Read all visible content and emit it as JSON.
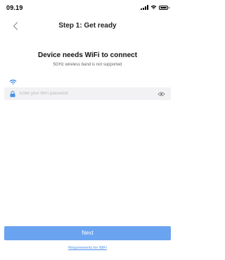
{
  "status_bar": {
    "time": "09.19"
  },
  "nav": {
    "title": "Step 1: Get ready"
  },
  "main": {
    "heading": "Device needs WiFi to connect",
    "subheading": "5GHz wireless band is not supported"
  },
  "password": {
    "placeholder": "Enter your WiFi password",
    "value": ""
  },
  "actions": {
    "next_label": "Next",
    "requirements_link": "Requirements for WiFi"
  },
  "colors": {
    "accent": "#6aa3f0",
    "link": "#4a8fe8",
    "field_bg": "#f2f2f4"
  },
  "icons": [
    "signal-icon",
    "wifi-status-icon",
    "battery-icon",
    "back-chevron-icon",
    "wifi-icon",
    "lock-icon",
    "eye-icon"
  ]
}
